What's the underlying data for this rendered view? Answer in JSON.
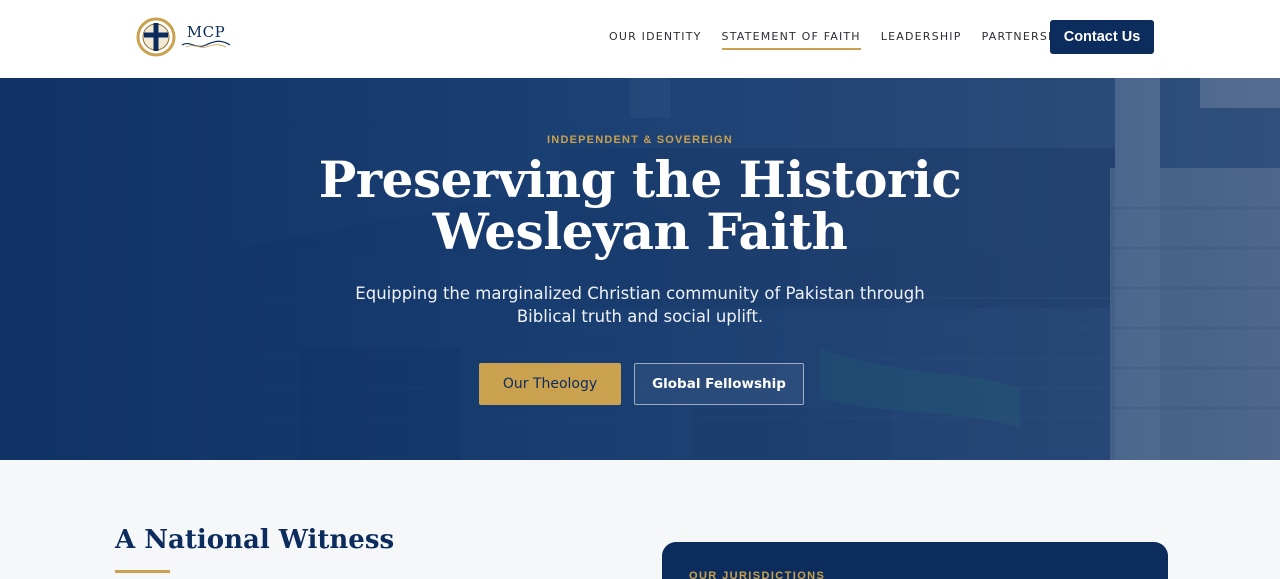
{
  "header": {
    "logo_text": "MCP",
    "nav": [
      {
        "label": "OUR IDENTITY",
        "active": false
      },
      {
        "label": "STATEMENT OF FAITH",
        "active": true
      },
      {
        "label": "LEADERSHIP",
        "active": false
      },
      {
        "label": "PARTNERSHIPS",
        "active": false
      }
    ],
    "contact_label": "Contact Us"
  },
  "hero": {
    "eyebrow": "INDEPENDENT & SOVEREIGN",
    "title": "Preserving the Historic Wesleyan Faith",
    "subtitle": "Equipping the marginalized Christian community of Pakistan through Biblical truth and social uplift.",
    "primary_button": "Our Theology",
    "secondary_button": "Global Fellowship"
  },
  "section": {
    "title": "A National Witness",
    "card_label": "OUR JURISDICTIONS"
  },
  "colors": {
    "navy": "#0b2c5c",
    "gold": "#c9a14f"
  }
}
